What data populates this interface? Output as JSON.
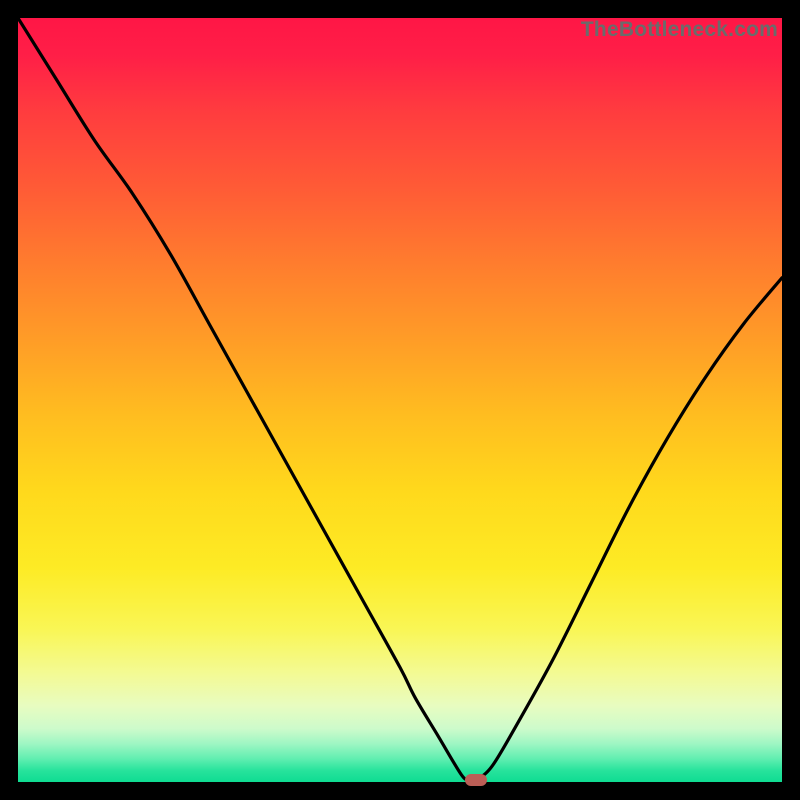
{
  "watermark": "TheBottleneck.com",
  "colors": {
    "frame": "#000000",
    "curve": "#000000",
    "marker": "#bb5e56",
    "watermark": "#6b6b6b"
  },
  "chart_data": {
    "type": "line",
    "title": "",
    "xlabel": "",
    "ylabel": "",
    "xlim": [
      0,
      100
    ],
    "ylim": [
      0,
      100
    ],
    "grid": false,
    "legend": false,
    "series": [
      {
        "name": "bottleneck-curve",
        "x": [
          0,
          5,
          10,
          15,
          20,
          25,
          30,
          35,
          40,
          45,
          50,
          52,
          55,
          58,
          59,
          60,
          62,
          65,
          70,
          75,
          80,
          85,
          90,
          95,
          100
        ],
        "values": [
          100,
          92,
          84,
          77,
          69,
          60,
          51,
          42,
          33,
          24,
          15,
          11,
          6,
          1,
          0.3,
          0.3,
          2,
          7,
          16,
          26,
          36,
          45,
          53,
          60,
          66
        ]
      }
    ],
    "marker": {
      "x": 60,
      "y": 0.3
    },
    "gradient_stops": [
      {
        "pos": 0,
        "color": "#ff1646"
      },
      {
        "pos": 0.5,
        "color": "#ffbd20"
      },
      {
        "pos": 0.82,
        "color": "#f9f655"
      },
      {
        "pos": 1.0,
        "color": "#0fdc92"
      }
    ]
  }
}
